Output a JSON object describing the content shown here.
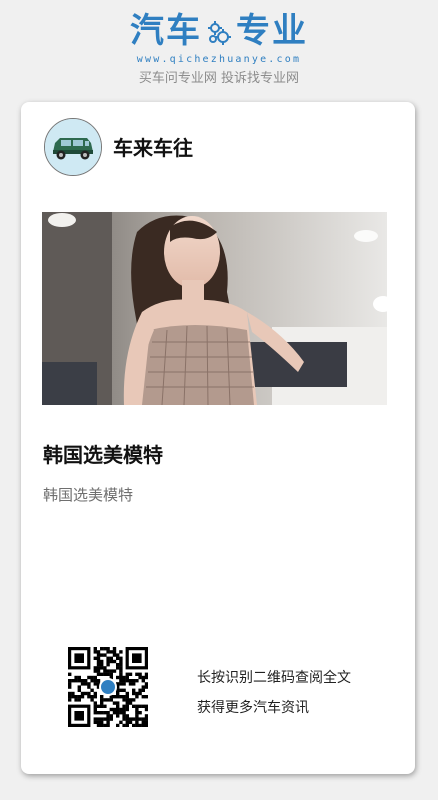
{
  "brand": {
    "name_part1": "汽车",
    "name_part2": "专业",
    "url": "www.qichezhuanye.com",
    "slogan": "买车问专业网 投诉找专业网",
    "color": "#2f7fc1"
  },
  "card": {
    "author": {
      "name": "车来车往",
      "avatar_icon": "car-avatar-icon"
    },
    "cover_image": "photo-of-model",
    "title": "韩国选美模特",
    "description": "韩国选美模特",
    "qr": {
      "icon": "qr-code-icon",
      "line1": "长按识别二维码查阅全文",
      "line2": "获得更多汽车资讯"
    }
  }
}
